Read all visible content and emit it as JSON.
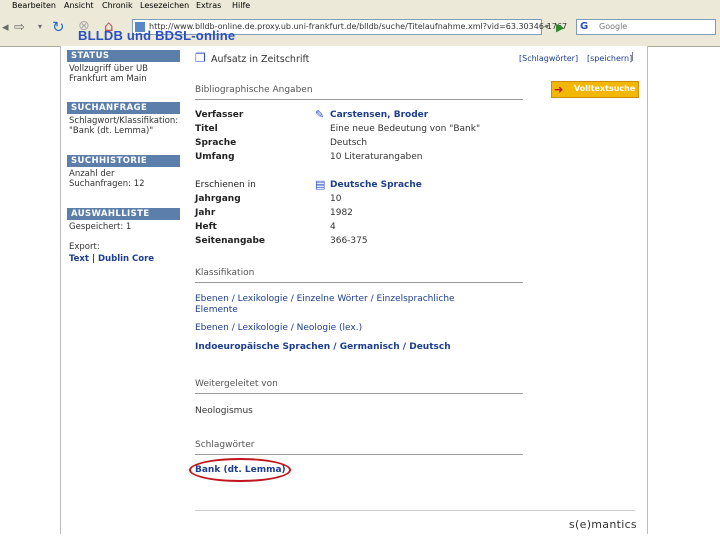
{
  "browser": {
    "menu": [
      "Bearbeiten",
      "Ansicht",
      "Chronik",
      "Lesezeichen",
      "Extras",
      "Hilfe"
    ],
    "url": "http://www.blldb-online.de.proxy.ub.uni-frankfurt.de/blldb/suche/Titelaufnahme.xml?vid=63.30346-1767",
    "search_placeholder": "Google"
  },
  "overlay_title": "BLLDB und BDSL-online",
  "page": {
    "heading": "Aufsatz in Zeitschrift",
    "top_links": [
      "[Schlagwörter]",
      "[speichern]"
    ],
    "fulltext_button": "Volltextsuche",
    "sidebar": {
      "status": {
        "title": "STATUS",
        "text": "Vollzugriff über UB Frankfurt am Main"
      },
      "suchanfrage": {
        "title": "SUCHANFRAGE",
        "text": "Schlagwort/Klassifikation: \"Bank (dt. Lemma)\""
      },
      "suchhistorie": {
        "title": "SUCHHISTORIE",
        "text": "Anzahl der Suchanfragen: 12"
      },
      "auswahlliste": {
        "title": "AUSWAHLLISTE",
        "text": "Gespeichert: 1",
        "export_label": "Export:",
        "export_links": "Text | Dublin Core"
      }
    },
    "biblio": {
      "title": "Bibliographische Angaben",
      "verfasser_label": "Verfasser",
      "verfasser": "Carstensen, Broder",
      "titel_label": "Titel",
      "titel": "Eine neue Bedeutung von \"Bank\"",
      "sprache_label": "Sprache",
      "sprache": "Deutsch",
      "umfang_label": "Umfang",
      "umfang": "10 Literaturangaben",
      "erschienen_label": "Erschienen in",
      "erschienen": "Deutsche Sprache",
      "jahrgang_label": "Jahrgang",
      "jahrgang": "10",
      "jahr_label": "Jahr",
      "jahr": "1982",
      "heft_label": "Heft",
      "heft": "4",
      "seiten_label": "Seitenangabe",
      "seiten": "366-375"
    },
    "klassifikation": {
      "title": "Klassifikation",
      "k1": "Ebenen / Lexikologie / Einzelne Wörter / Einzelsprachliche Elemente",
      "k2": "Ebenen / Lexikologie / Neologie (lex.)",
      "k3": "Indoeuropäische Sprachen / Germanisch / Deutsch"
    },
    "weitergeleitet": {
      "title": "Weitergeleitet von",
      "value": "Neologismus"
    },
    "schlagwoerter": {
      "title": "Schlagwörter",
      "value": "Bank (dt. Lemma)"
    },
    "footer_logo": "s(e)mantics"
  },
  "colors": {
    "link": "#1c3e8c",
    "sidebar_header": "#5c7eaa",
    "highlight_circle": "#c0151b",
    "fulltext_button": "#f2b705"
  }
}
